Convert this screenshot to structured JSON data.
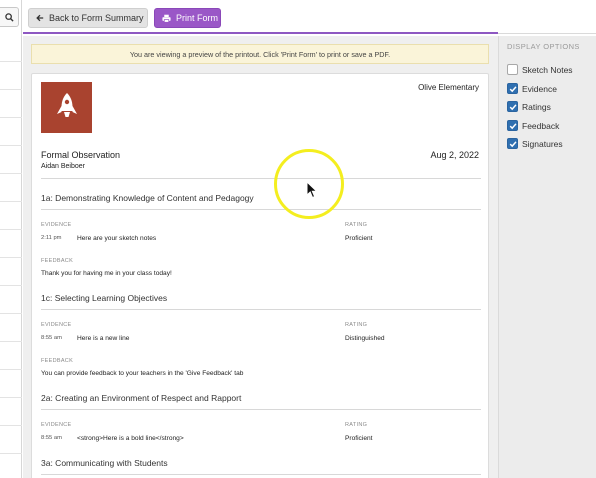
{
  "toolbar": {
    "back_label": "Back to Form Summary",
    "print_label": "Print Form",
    "back_icon": "arrow-left-icon",
    "print_icon": "printer-icon",
    "accent_color": "#9a57c7"
  },
  "notice": "You are viewing a preview of the printout. Click 'Print Form' to print or save a PDF.",
  "form": {
    "school": "Olive Elementary",
    "title": "Formal Observation",
    "date": "Aug 2, 2022",
    "teacher": "Aidan Beiboer",
    "logo_icon": "rocket-icon",
    "logo_color": "#a9432f",
    "sections": [
      {
        "title": "1a: Demonstrating Knowledge of Content and Pedagogy",
        "evidence_label": "EVIDENCE",
        "time": "2:11 pm",
        "evidence": "Here are your sketch notes",
        "rating_label": "RATING",
        "rating": "Proficient",
        "feedback_label": "FEEDBACK",
        "feedback": "Thank you for having me in your class today!"
      },
      {
        "title": "1c: Selecting Learning Objectives",
        "evidence_label": "EVIDENCE",
        "time": "8:55 am",
        "evidence": "Here is a new line",
        "rating_label": "RATING",
        "rating": "Distinguished",
        "feedback_label": "FEEDBACK",
        "feedback": "You can provide feedback to your teachers in the 'Give Feedback' tab"
      },
      {
        "title": "2a: Creating an Environment of Respect and Rapport",
        "evidence_label": "EVIDENCE",
        "time": "8:55 am",
        "evidence": "<strong>Here is a bold line</strong>",
        "rating_label": "RATING",
        "rating": "Proficient"
      },
      {
        "title": "3a: Communicating with Students"
      }
    ]
  },
  "display_options": {
    "heading": "DISPLAY OPTIONS",
    "checkbox_color": "#2f6fb0",
    "items": [
      {
        "label": "Sketch Notes",
        "checked": false
      },
      {
        "label": "Evidence",
        "checked": true
      },
      {
        "label": "Ratings",
        "checked": true
      },
      {
        "label": "Feedback",
        "checked": true
      },
      {
        "label": "Signatures",
        "checked": true
      }
    ]
  }
}
